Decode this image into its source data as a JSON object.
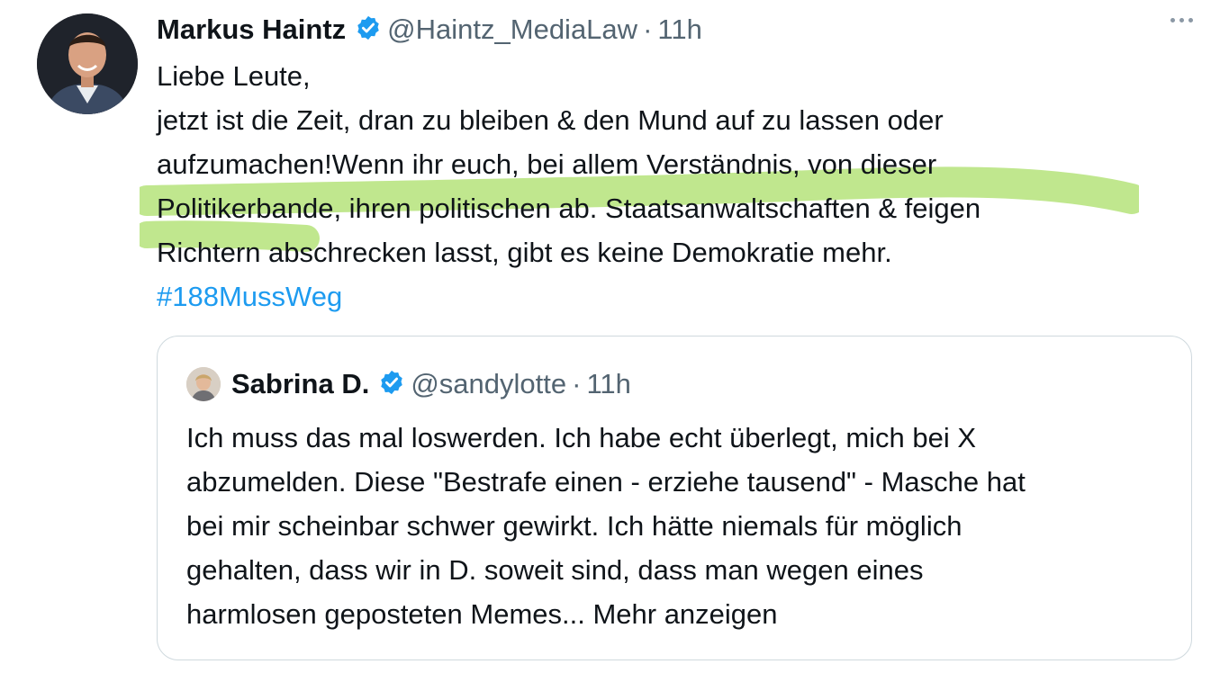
{
  "tweet": {
    "author_name": "Markus Haintz",
    "handle": "@Haintz_MediaLaw",
    "separator": "·",
    "time": "11h",
    "lines": [
      "Liebe Leute,",
      "jetzt ist die Zeit, dran zu bleiben & den Mund auf zu lassen oder",
      "aufzumachen!Wenn ihr euch, bei allem Verständnis, von dieser",
      "Politikerbande, ihren politischen ab. Staatsanwaltschaften & feigen",
      "Richtern abschrecken lasst, gibt es keine Demokratie mehr."
    ],
    "hashtag": "#188MussWeg"
  },
  "quote": {
    "author_name": "Sabrina D.",
    "handle": "@sandylotte",
    "separator": "·",
    "time": "11h",
    "lines": [
      "Ich muss das mal loswerden. Ich habe echt überlegt, mich bei X",
      "abzumelden. Diese \"Bestrafe einen - erziehe tausend\" - Masche hat",
      "bei mir scheinbar schwer gewirkt. Ich hätte niemals für möglich",
      "gehalten, dass wir in D. soweit sind, dass man wegen eines",
      "harmlosen geposteten Memes... Mehr anzeigen"
    ]
  },
  "icons": {
    "verified": "verified-badge-icon",
    "more": "more-options-icon"
  },
  "colors": {
    "text": "#0f1419",
    "secondary": "#536471",
    "link": "#1d9bf0",
    "highlight": "#b5e37a",
    "border": "#cfd9de"
  }
}
